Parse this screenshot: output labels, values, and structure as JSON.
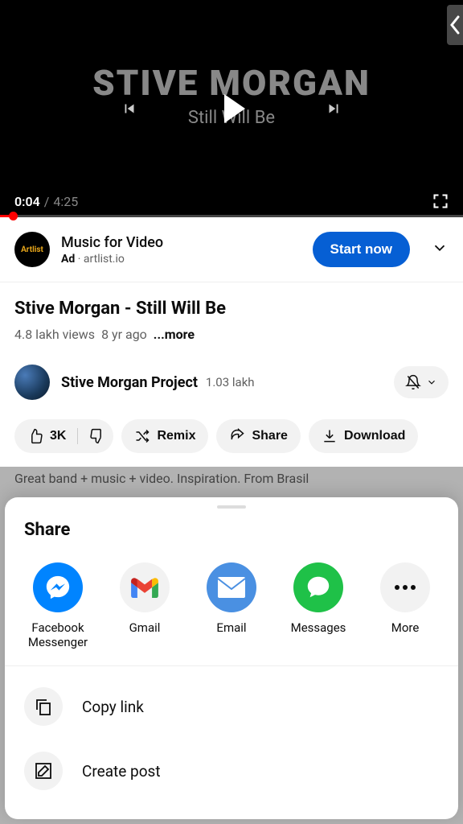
{
  "player": {
    "artist": "STIVE MORGAN",
    "subtitle": "Still Will Be",
    "current_time": "0:04",
    "total_time": "4:25"
  },
  "ad": {
    "logo_text": "Artlist",
    "title": "Music for Video",
    "label": "Ad",
    "source": "artlist.io",
    "cta": "Start now"
  },
  "video": {
    "title": "Stive Morgan - Still Will Be",
    "views": "4.8 lakh views",
    "age": "8 yr ago",
    "more": "...more"
  },
  "channel": {
    "name": "Stive Morgan Project",
    "subs": "1.03 lakh"
  },
  "actions": {
    "like_count": "3K",
    "remix": "Remix",
    "share": "Share",
    "download": "Download"
  },
  "comment_peek": "Great band + music + video. Inspiration. From Brasil",
  "sheet": {
    "title": "Share",
    "apps": [
      {
        "label": "Facebook Messenger"
      },
      {
        "label": "Gmail"
      },
      {
        "label": "Email"
      },
      {
        "label": "Messages"
      },
      {
        "label": "More"
      }
    ],
    "list": [
      {
        "label": "Copy link"
      },
      {
        "label": "Create post"
      }
    ]
  }
}
